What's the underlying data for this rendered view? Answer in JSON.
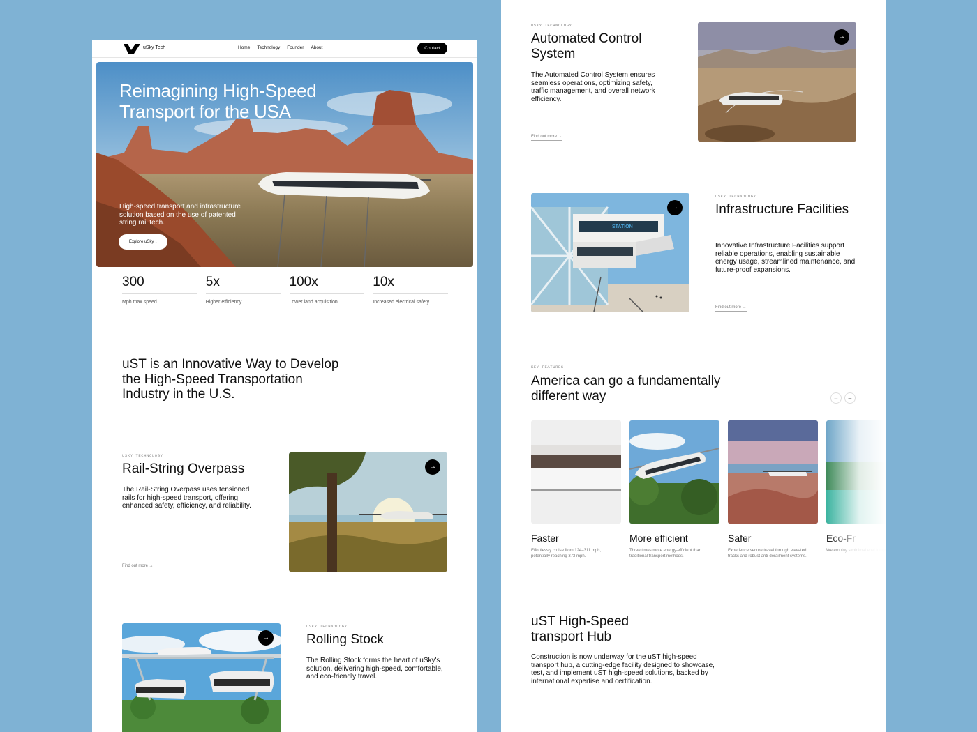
{
  "nav": {
    "brand": "uSky Tech",
    "links": [
      "Home",
      "Technology",
      "Founder",
      "About"
    ],
    "contact": "Contact"
  },
  "hero": {
    "title": "Reimagining High-Speed Transport for the USA",
    "subtitle": "High-speed transport and infrastructure solution based on the use of patented string rail tech.",
    "cta": "Explore uSky"
  },
  "stats": [
    {
      "value": "300",
      "label": "Mph max speed"
    },
    {
      "value": "5x",
      "label": "Higher efficiency"
    },
    {
      "value": "100x",
      "label": "Lower land acquisition"
    },
    {
      "value": "10x",
      "label": "Increased electrical safety"
    }
  ],
  "intro": {
    "heading": "uST is an Innovative Way to Develop the High-Speed Transportation Industry in the U.S."
  },
  "sections": {
    "rail_string": {
      "eyebrow": "uSky Technology",
      "title": "Rail-String Overpass",
      "body": "The Rail-String Overpass uses tensioned rails for high-speed transport, offering enhanced safety, efficiency, and reliability.",
      "link": "Find out more →"
    },
    "rolling_stock": {
      "eyebrow": "uSky Technology",
      "title": "Rolling Stock",
      "body": "The Rolling Stock forms the heart of uSky's solution, delivering high-speed, comfortable, and eco-friendly travel."
    },
    "automated": {
      "eyebrow": "uSky Technology",
      "title": "Automated Control System",
      "body": "The Automated Control System ensures seamless operations, optimizing safety, traffic management, and overall network efficiency.",
      "link": "Find out more →"
    },
    "infrastructure": {
      "eyebrow": "uSky Technology",
      "title": "Infrastructure Facilities",
      "body": "Innovative Infrastructure Facilities support reliable operations, enabling sustainable energy usage, streamlined maintenance, and future-proof expansions.",
      "link": "Find out more →"
    }
  },
  "features": {
    "eyebrow": "Key features",
    "title": "America can go a fundamentally different way",
    "prev": "←",
    "next": "→",
    "items": [
      {
        "title": "Faster",
        "desc": "Effortlessly cruise from 124–311 mph, potentially reaching 373 mph."
      },
      {
        "title": "More efficient",
        "desc": "Three times more energy-efficient than traditional transport methods."
      },
      {
        "title": "Safer",
        "desc": "Experience secure travel through elevated tracks and robust anti-derailment systems."
      },
      {
        "title": "Eco-Fr",
        "desc": "We employ s minimal envi footprint."
      }
    ]
  },
  "hub": {
    "title": "uST High-Speed transport Hub",
    "body": "Construction is now underway for the uST high-speed transport hub, a cutting-edge facility designed to showcase, test, and implement uST high-speed solutions, backed by international expertise and certification."
  },
  "ui": {
    "arrow": "→",
    "explore_arrow": "↓",
    "station_sign": "STATION"
  }
}
